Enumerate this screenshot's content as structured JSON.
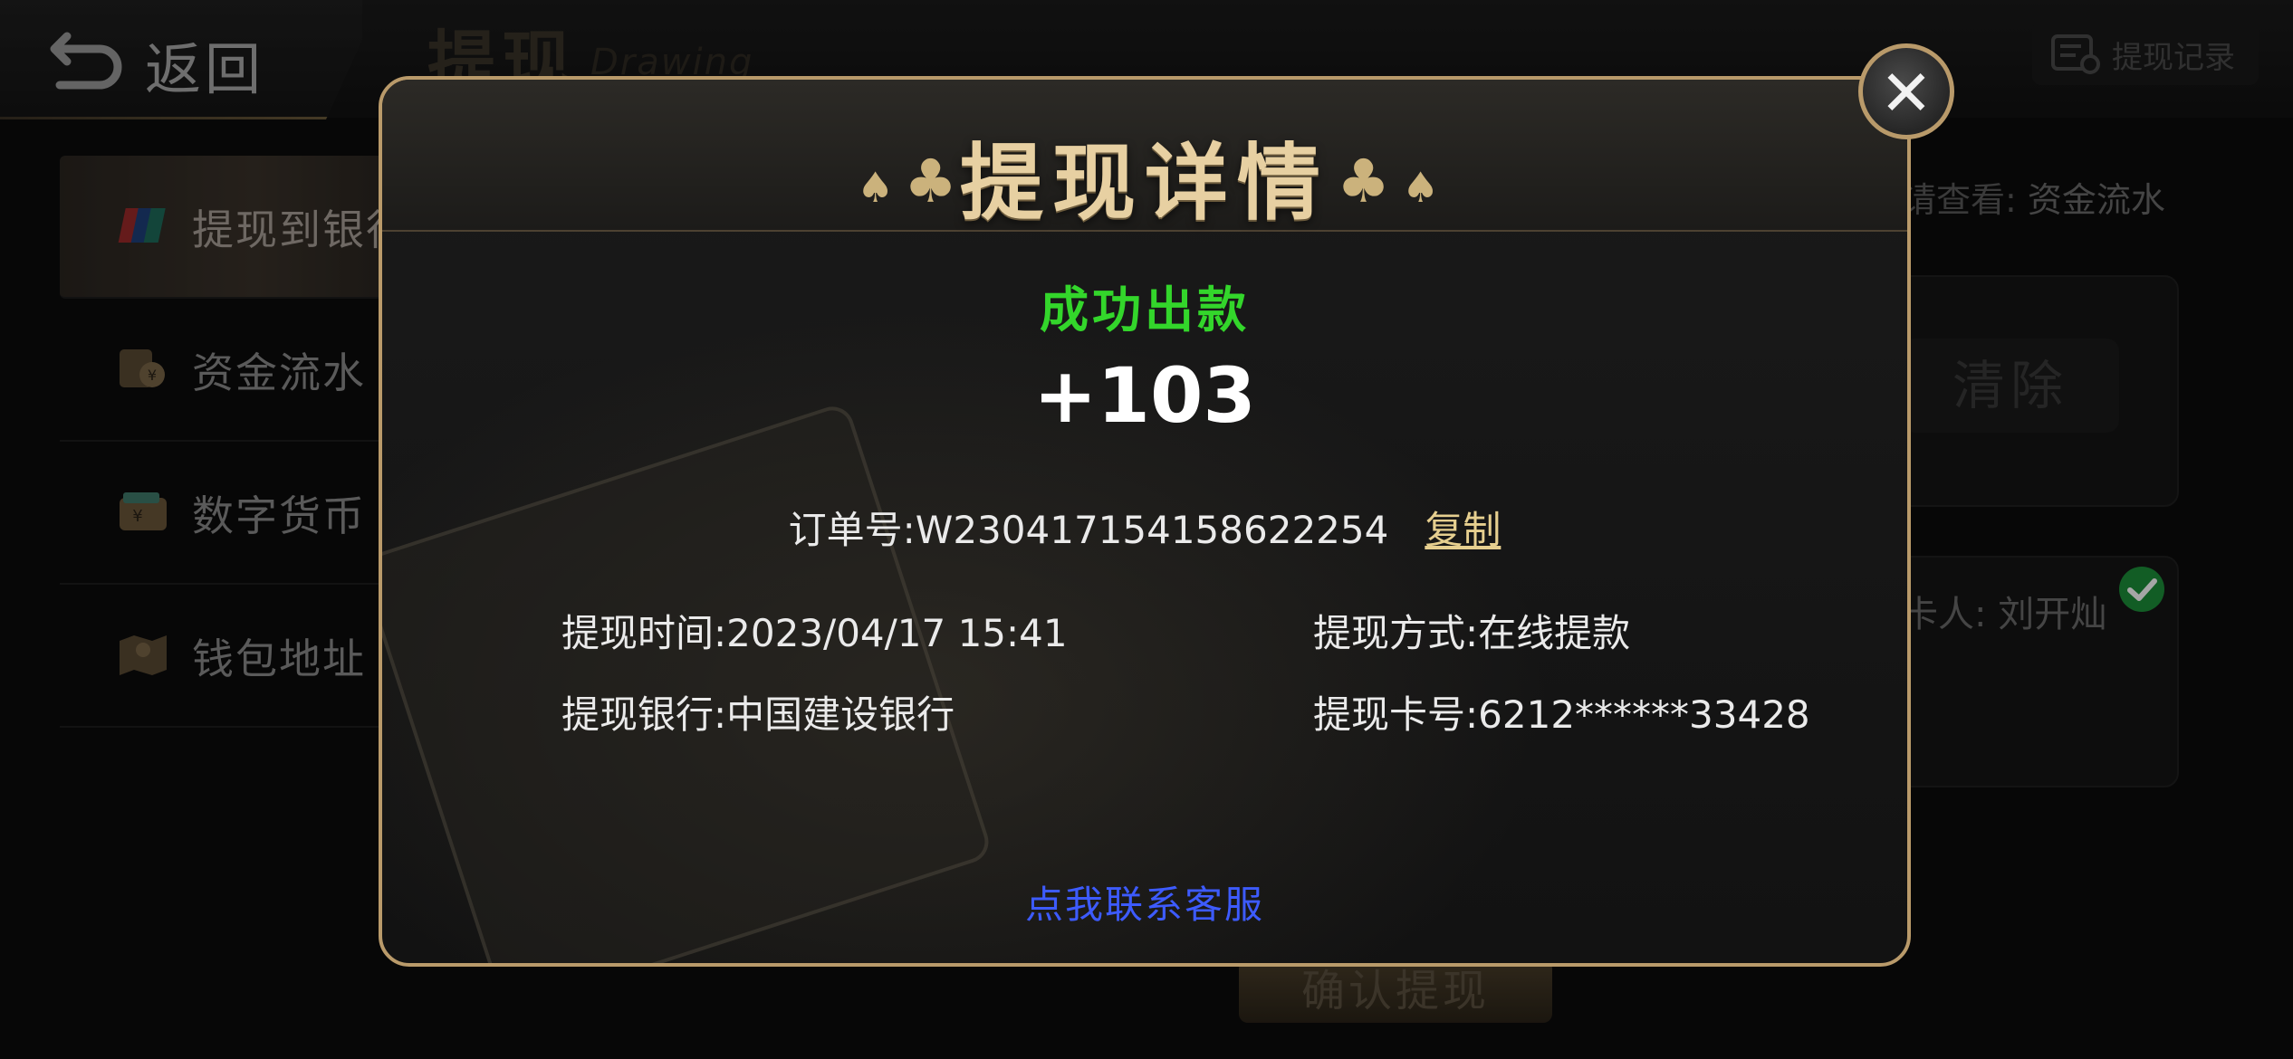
{
  "header": {
    "back_label": "返回",
    "title": "提现",
    "subtitle": "Drawing",
    "history_label": "提现记录"
  },
  "sidebar": {
    "items": [
      {
        "label": "提现到银行卡",
        "icon": "unionpay-card-icon",
        "active": true
      },
      {
        "label": "资金流水",
        "icon": "money-flow-icon",
        "active": false
      },
      {
        "label": "数字货币",
        "icon": "wallet-icon",
        "active": false
      },
      {
        "label": "钱包地址",
        "icon": "map-icon",
        "active": false
      }
    ]
  },
  "background_content": {
    "hint_prefix": "请查看:",
    "hint_link": "资金流水",
    "clear_label": "清除",
    "cardholder": "卡人: 刘开灿",
    "confirm_label": "确认提现"
  },
  "modal": {
    "title": "提现详情",
    "status": "成功出款",
    "amount": "+103",
    "order_label": "订单号:W230417154158622254",
    "copy_label": "复制",
    "time": "提现时间:2023/04/17 15:41",
    "method": "提现方式:在线提款",
    "bank": "提现银行:中国建设银行",
    "card_no": "提现卡号:6212******33428",
    "support_link": "点我联系客服",
    "close_icon": "close-icon"
  },
  "colors": {
    "accent_gold": "#b99a6a",
    "status_green": "#33d62b",
    "support_blue": "#3d5bff",
    "title_gold": "#e7d0a2"
  }
}
